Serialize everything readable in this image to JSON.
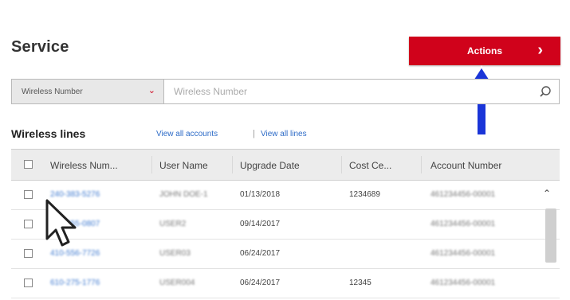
{
  "header": {
    "title": "Service",
    "actions_label": "Actions",
    "actions_chevron": "›"
  },
  "search": {
    "type_selected": "Wireless Number",
    "placeholder": "Wireless Number"
  },
  "lines": {
    "title": "Wireless lines",
    "view_all_accounts": "View all accounts",
    "separator": "|",
    "view_all_lines": "View all lines"
  },
  "table": {
    "headers": [
      "Wireless Num...",
      "User Name",
      "Upgrade Date",
      "Cost Ce...",
      "Account Number"
    ],
    "rows": [
      {
        "number": "240-383-5276",
        "user": "JOHN DOE-1",
        "date": "01/13/2018",
        "cost": "1234689",
        "account": "461234456-00001"
      },
      {
        "number": "440-255-0807",
        "user": "USER2",
        "date": "09/14/2017",
        "cost": "",
        "account": "461234456-00001"
      },
      {
        "number": "410-556-7726",
        "user": "USER03",
        "date": "06/24/2017",
        "cost": "",
        "account": "461234456-00001"
      },
      {
        "number": "610-275-1776",
        "user": "USER004",
        "date": "06/24/2017",
        "cost": "12345",
        "account": "461234456-00001"
      }
    ]
  },
  "colors": {
    "accent_red": "#d0021b",
    "link_blue": "#2d6bc7",
    "annotation_blue": "#1a35d8"
  }
}
